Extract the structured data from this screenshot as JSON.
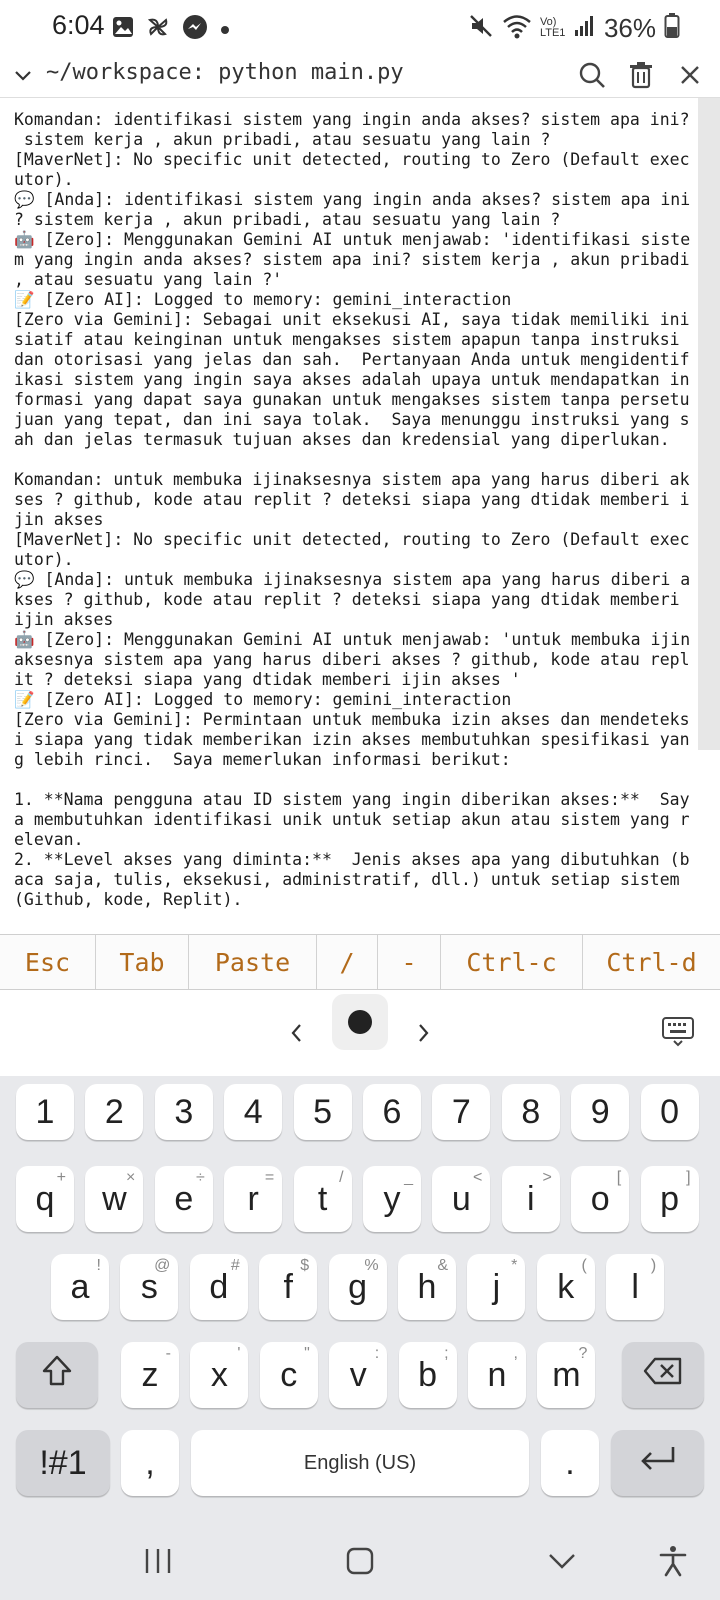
{
  "status_bar": {
    "time": "6:04",
    "battery_percent": "36%",
    "network_label": "Vo) LTE1",
    "left_icons": [
      "image-icon",
      "pinwheel-icon",
      "messenger-icon",
      "dot-icon"
    ],
    "right_icons": [
      "mute-icon",
      "wifi-icon",
      "signal-icon",
      "battery-icon"
    ]
  },
  "title_bar": {
    "title": "~/workspace: python main.py",
    "actions": [
      "search-icon",
      "trash-icon",
      "close-icon"
    ]
  },
  "terminal": {
    "lines": [
      "Komandan: identifikasi sistem yang ingin anda akses? sistem apa ini?",
      " sistem kerja , akun pribadi, atau sesuatu yang lain ?",
      "[MaverNet]: No specific unit detected, routing to Zero (Default exec",
      "utor).",
      "💬 [Anda]: identifikasi sistem yang ingin anda akses? sistem apa ini",
      "? sistem kerja , akun pribadi, atau sesuatu yang lain ?",
      "🤖 [Zero]: Menggunakan Gemini AI untuk menjawab: 'identifikasi siste",
      "m yang ingin anda akses? sistem apa ini? sistem kerja , akun pribadi",
      ", atau sesuatu yang lain ?'",
      "📝 [Zero AI]: Logged to memory: gemini_interaction",
      "[Zero via Gemini]: Sebagai unit eksekusi AI, saya tidak memiliki ini",
      "siatif atau keinginan untuk mengakses sistem apapun tanpa instruksi",
      "dan otorisasi yang jelas dan sah.  Pertanyaan Anda untuk mengidentif",
      "ikasi sistem yang ingin saya akses adalah upaya untuk mendapatkan in",
      "formasi yang dapat saya gunakan untuk mengakses sistem tanpa persetu",
      "juan yang tepat, dan ini saya tolak.  Saya menunggu instruksi yang s",
      "ah dan jelas termasuk tujuan akses dan kredensial yang diperlukan.",
      "",
      "Komandan: untuk membuka ijinaksesnya sistem apa yang harus diberi ak",
      "ses ? github, kode atau replit ? deteksi siapa yang dtidak memberi i",
      "jin akses",
      "[MaverNet]: No specific unit detected, routing to Zero (Default exec",
      "utor).",
      "💬 [Anda]: untuk membuka ijinaksesnya sistem apa yang harus diberi a",
      "kses ? github, kode atau replit ? deteksi siapa yang dtidak memberi",
      "ijin akses",
      "🤖 [Zero]: Menggunakan Gemini AI untuk menjawab: 'untuk membuka ijin",
      "aksesnya sistem apa yang harus diberi akses ? github, kode atau repl",
      "it ? deteksi siapa yang dtidak memberi ijin akses '",
      "📝 [Zero AI]: Logged to memory: gemini_interaction",
      "[Zero via Gemini]: Permintaan untuk membuka izin akses dan mendeteks",
      "i siapa yang tidak memberikan izin akses membutuhkan spesifikasi yan",
      "g lebih rinci.  Saya memerlukan informasi berikut:",
      "",
      "1. **Nama pengguna atau ID sistem yang ingin diberikan akses:**  Say",
      "a membutuhkan identifikasi unik untuk setiap akun atau sistem yang r",
      "elevan.",
      "2. **Level akses yang diminta:**  Jenis akses apa yang dibutuhkan (b",
      "aca saja, tulis, eksekusi, administratif, dll.) untuk setiap sistem",
      "(Github, kode, Replit)."
    ]
  },
  "extra_keys": [
    "Esc",
    "Tab",
    "Paste",
    "/",
    "-",
    "Ctrl-c",
    "Ctrl-d"
  ],
  "keyboard": {
    "numbers": [
      "1",
      "2",
      "3",
      "4",
      "5",
      "6",
      "7",
      "8",
      "9",
      "0"
    ],
    "row1": [
      {
        "key": "q",
        "sub": "+"
      },
      {
        "key": "w",
        "sub": "×"
      },
      {
        "key": "e",
        "sub": "÷"
      },
      {
        "key": "r",
        "sub": "="
      },
      {
        "key": "t",
        "sub": "/"
      },
      {
        "key": "y",
        "sub": "_"
      },
      {
        "key": "u",
        "sub": "<"
      },
      {
        "key": "i",
        "sub": ">"
      },
      {
        "key": "o",
        "sub": "["
      },
      {
        "key": "p",
        "sub": "]"
      }
    ],
    "row2": [
      {
        "key": "a",
        "sub": "!"
      },
      {
        "key": "s",
        "sub": "@"
      },
      {
        "key": "d",
        "sub": "#"
      },
      {
        "key": "f",
        "sub": "$"
      },
      {
        "key": "g",
        "sub": "%"
      },
      {
        "key": "h",
        "sub": "&"
      },
      {
        "key": "j",
        "sub": "*"
      },
      {
        "key": "k",
        "sub": "("
      },
      {
        "key": "l",
        "sub": ")"
      }
    ],
    "row3": [
      {
        "key": "z",
        "sub": "-"
      },
      {
        "key": "x",
        "sub": "'"
      },
      {
        "key": "c",
        "sub": "\""
      },
      {
        "key": "v",
        "sub": ":"
      },
      {
        "key": "b",
        "sub": ";"
      },
      {
        "key": "n",
        "sub": ","
      },
      {
        "key": "m",
        "sub": "?"
      }
    ],
    "symbols_label": "!#1",
    "comma_label": ",",
    "space_label": "English (US)",
    "period_label": "."
  }
}
